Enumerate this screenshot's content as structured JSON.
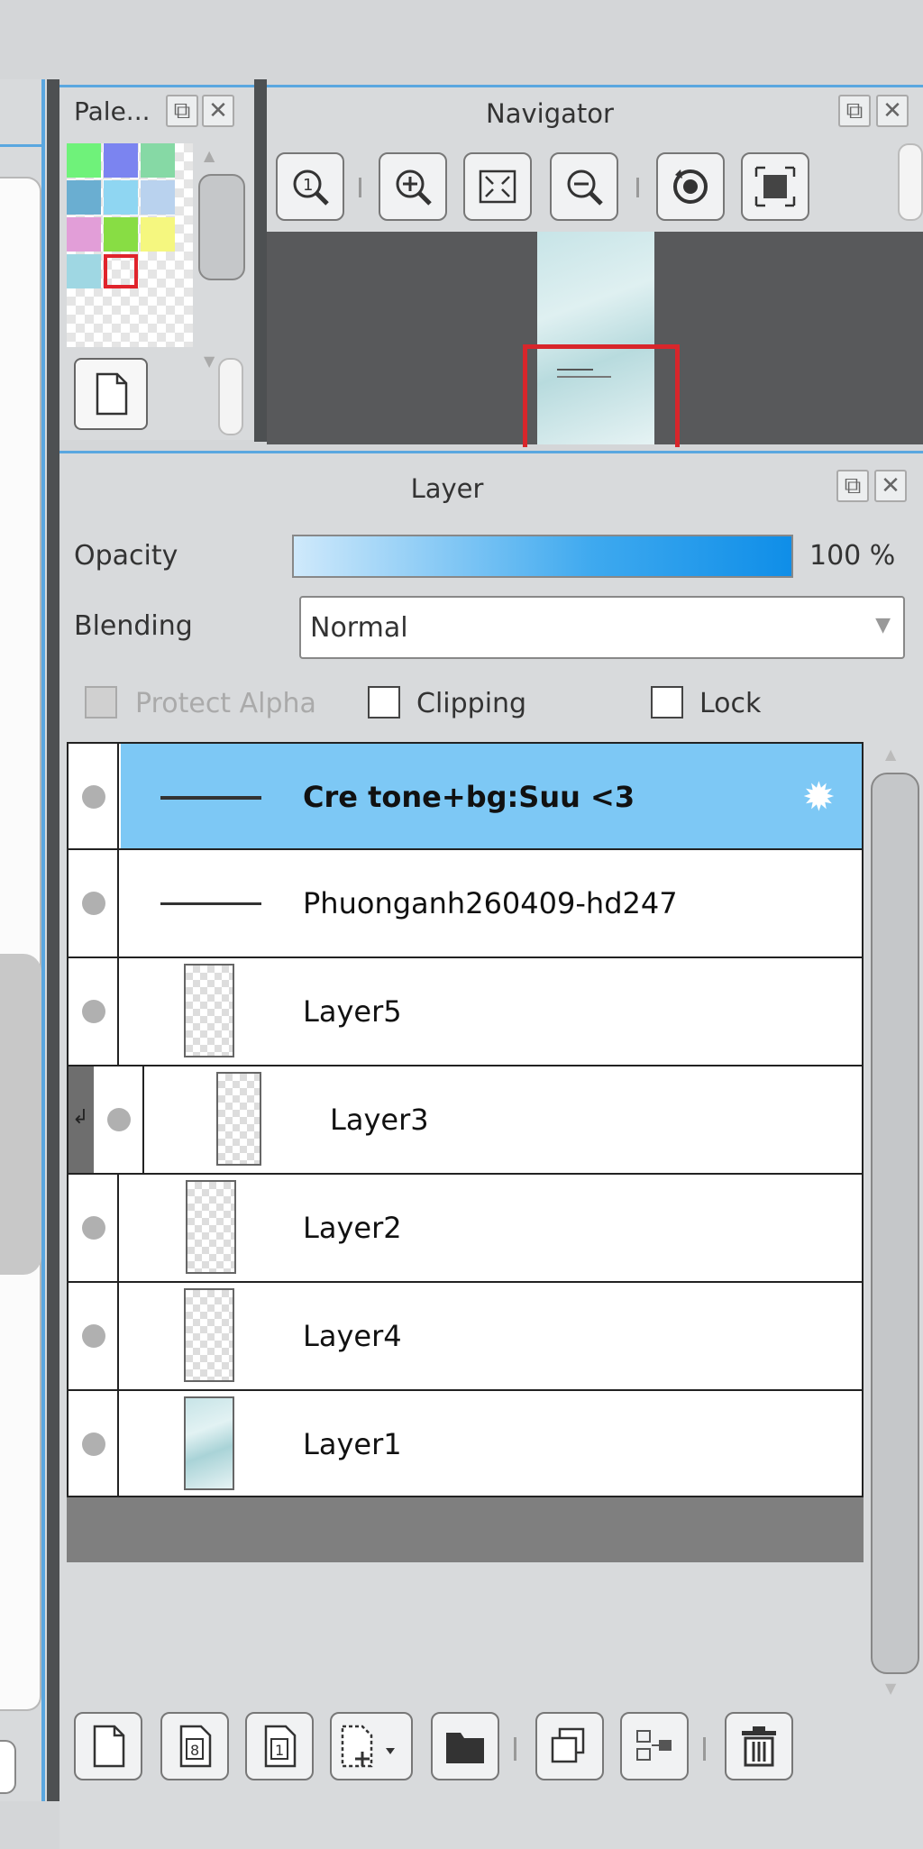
{
  "palette": {
    "title": "Pale...",
    "swatches": [
      "#6ff27a",
      "#7b84f0",
      "#86d9a5",
      "#6aaed1",
      "#8fd6f2",
      "#b9d2ee",
      "#e29ed8",
      "#88dd44",
      "#f5f77f",
      "#9fd7e3",
      "empty"
    ],
    "selected_index": 10
  },
  "navigator": {
    "title": "Navigator"
  },
  "layer_panel": {
    "title": "Layer",
    "opacity_label": "Opacity",
    "opacity_value": "100 %",
    "opacity_fraction": 1.0,
    "blending_label": "Blending",
    "blending_value": "Normal",
    "protect_alpha_label": "Protect Alpha",
    "clipping_label": "Clipping",
    "lock_label": "Lock",
    "layers": [
      {
        "name": "Cre tone+bg:Suu <3",
        "selected": true
      },
      {
        "name": "Phuonganh260409-hd247",
        "selected": false
      },
      {
        "name": "Layer5",
        "selected": false
      },
      {
        "name": "Layer3",
        "selected": false,
        "clipped": true
      },
      {
        "name": "Layer2",
        "selected": false
      },
      {
        "name": "Layer4",
        "selected": false
      },
      {
        "name": "Layer1",
        "selected": false
      }
    ]
  },
  "colors": {
    "accent": "#5aa7e0",
    "selection": "#7dc8f5",
    "panel_bg": "#d8dadc",
    "dark_divider": "#4d5052",
    "nav_frame": "#d8262b"
  }
}
